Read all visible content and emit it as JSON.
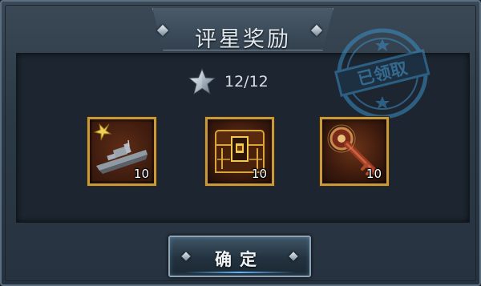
{
  "dialog": {
    "title": "评星奖励",
    "stamp_text": "已领取",
    "stars": {
      "icon": "silver-star-icon",
      "progress_text": "12/12"
    },
    "rewards": [
      {
        "name": "warship-card-icon",
        "count": "10"
      },
      {
        "name": "golden-chest-icon",
        "count": "10"
      },
      {
        "name": "ornate-key-icon",
        "count": "10"
      }
    ],
    "confirm_label": "确定"
  },
  "colors": {
    "frame_gold": "#c99a3b",
    "stamp_blue": "#3b8fc7",
    "panel_dark": "#1c2530"
  }
}
